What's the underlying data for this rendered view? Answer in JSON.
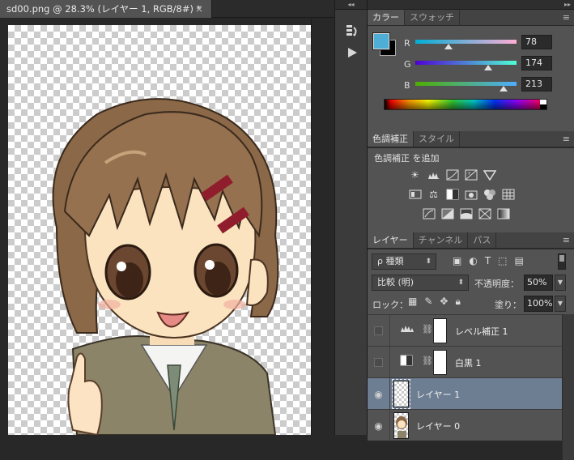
{
  "document": {
    "tab_title": "sd00.png @ 28.3% (レイヤー 1, RGB/8#) *",
    "close_glyph": "×"
  },
  "toolstrip": {
    "grip_glyph": "◂◂",
    "history_icon": "history-icon",
    "play_icon": "play-icon"
  },
  "panels_grip": "▸▸",
  "color_panel": {
    "tabs": [
      "カラー",
      "スウォッチ"
    ],
    "foreground_color": "#4eaed5",
    "background_color": "#000000",
    "channels": [
      {
        "label": "R",
        "value": "78",
        "fraction": 0.306
      },
      {
        "label": "G",
        "value": "174",
        "fraction": 0.682
      },
      {
        "label": "B",
        "value": "213",
        "fraction": 0.835
      }
    ]
  },
  "adjustments_panel": {
    "tabs": [
      "色調補正",
      "スタイル"
    ],
    "title": "色調補正 を追加"
  },
  "layers_panel": {
    "tabs": [
      "レイヤー",
      "チャンネル",
      "パス"
    ],
    "filter_kind": "ρ 種類",
    "blend_mode": "比較 (明)",
    "opacity_label": "不透明度：",
    "opacity_value": "50%",
    "lock_label": "ロック：",
    "fill_label": "塗り：",
    "fill_value": "100%",
    "layers": [
      {
        "name": "レベル補正 1",
        "visible": false,
        "type": "levels"
      },
      {
        "name": "白黒 1",
        "visible": false,
        "type": "bw"
      },
      {
        "name": "レイヤー 1",
        "visible": true,
        "type": "pixel",
        "selected": true
      },
      {
        "name": "レイヤー 0",
        "visible": true,
        "type": "pixel-image"
      }
    ]
  },
  "icons": {
    "menu": "≡",
    "eye": "👁"
  }
}
